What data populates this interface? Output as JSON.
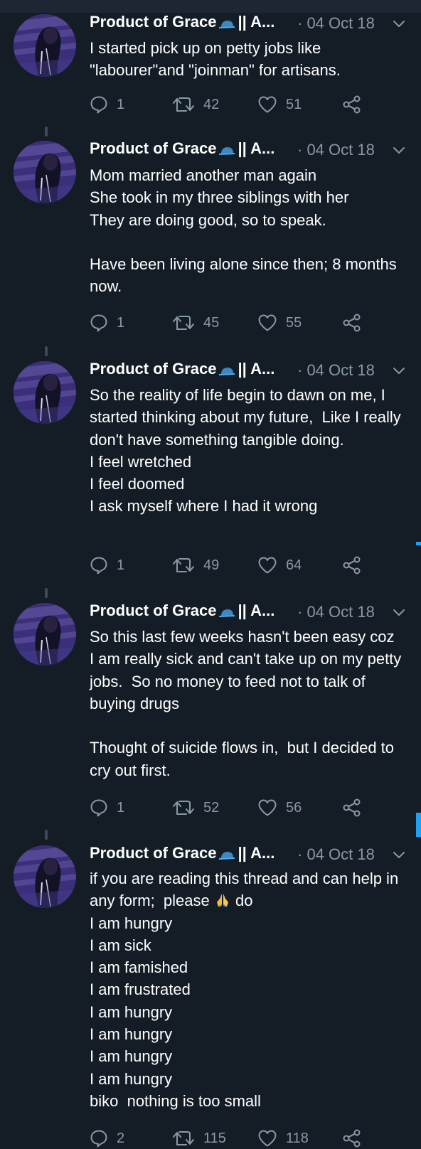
{
  "author": {
    "name": "Product of Grace",
    "handle_suffix": "|| A...",
    "date": "· 04 Oct 18"
  },
  "icons": {
    "cap": "blue-cap-emoji",
    "reply": "reply-icon",
    "retweet": "retweet-icon",
    "like": "heart-icon",
    "share": "share-icon",
    "menu": "chevron-down-icon",
    "pray": "folded-hands-emoji"
  },
  "colors": {
    "background": "#141d26",
    "muted": "#8899a6",
    "accent": "#1da1f2"
  },
  "tweets": [
    {
      "text": "I started pick up on petty jobs like \"labourer\"and \"joinman\" for artisans.",
      "replies": "1",
      "retweets": "42",
      "likes": "51"
    },
    {
      "text": "Mom married another man again\nShe took in my three siblings with her\nThey are doing good, so to speak.\n\nHave been living alone since then; 8 months now.",
      "replies": "1",
      "retweets": "45",
      "likes": "55"
    },
    {
      "text": "So the reality of life begin to dawn on me, I started thinking about my future,  Like I really don't have something tangible doing.\nI feel wretched\nI feel doomed\nI ask myself where I had it wrong",
      "replies": "1",
      "retweets": "49",
      "likes": "64"
    },
    {
      "text": "So this last few weeks hasn't been easy coz I am really sick and can't take up on my petty jobs.  So no money to feed not to talk of buying drugs\n\nThought of suicide flows in,  but I decided to cry out first.",
      "replies": "1",
      "retweets": "52",
      "likes": "56"
    },
    {
      "text_before_emoji": "if you are reading this thread and can help in any form;  please ",
      "text_after_emoji": " do\nI am hungry\nI am sick\nI am famished\nI am frustrated\nI am hungry\nI am hungry\nI am hungry\nI am hungry\nbiko  nothing is too small",
      "replies": "2",
      "retweets": "115",
      "likes": "118"
    }
  ]
}
